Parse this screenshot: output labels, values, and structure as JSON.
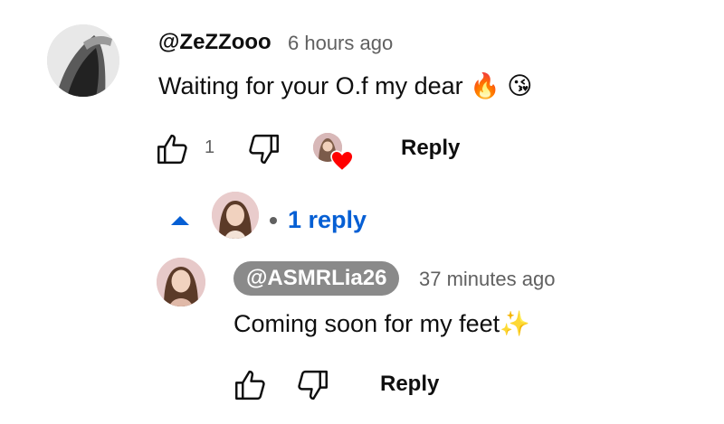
{
  "comment": {
    "author": "@ZeZZooo",
    "time": "6 hours ago",
    "text": "Waiting for your O.f my dear 🔥 😘",
    "like_count": "1",
    "reply_label": "Reply",
    "icons": [
      "thumb-up-icon",
      "thumb-down-icon",
      "creator-heart-icon"
    ]
  },
  "replies_toggle": {
    "label": "1 reply",
    "accent": "#065fd4"
  },
  "reply": {
    "author": "@ASMRLia26",
    "time": "37 minutes ago",
    "text": "Coming soon for my feet✨",
    "reply_label": "Reply"
  },
  "colors": {
    "heart": "#ff0000",
    "author_chip": "#8a8a8a",
    "muted_text": "#606060"
  }
}
